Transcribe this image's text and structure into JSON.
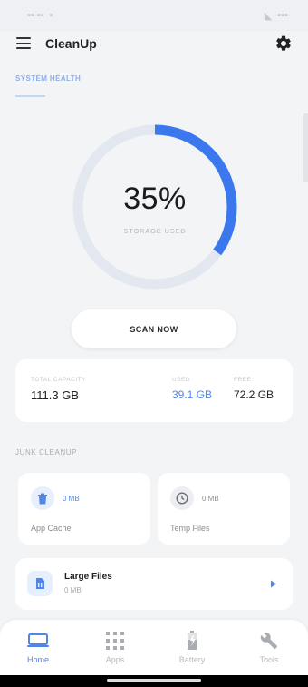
{
  "app": {
    "title": "CleanUp"
  },
  "tabs": [
    {
      "label": "SYSTEM HEALTH",
      "active": true
    }
  ],
  "gauge": {
    "percent_text": "35%",
    "caption": "STORAGE USED",
    "used_fraction": 0.35,
    "track_color": "#e3e8f0",
    "fill_color": "#3b78ee"
  },
  "scan": {
    "label": "SCAN NOW"
  },
  "storage": {
    "total_label": "TOTAL CAPACITY",
    "total_value": "111.3 GB",
    "used_label": "USED",
    "used_value": "39.1 GB",
    "free_label": "FREE",
    "free_value": "72.2 GB"
  },
  "junk": {
    "section_title": "JUNK CLEANUP",
    "app_cache": {
      "size": "0 MB",
      "name": "App Cache",
      "icon": "trash-icon"
    },
    "temp_files": {
      "size": "0 MB",
      "name": "Temp Files",
      "icon": "clock-icon"
    },
    "large_files": {
      "name": "Large Files",
      "size": "0 MB",
      "icon": "file-icon"
    }
  },
  "nav": [
    {
      "label": "Home",
      "icon": "monitor-icon",
      "active": true
    },
    {
      "label": "Apps",
      "icon": "grid-icon",
      "active": false
    },
    {
      "label": "Battery",
      "icon": "battery-icon",
      "active": false
    },
    {
      "label": "Tools",
      "icon": "wrench-icon",
      "active": false
    }
  ],
  "colors": {
    "accent": "#4f86e8",
    "background": "#f3f4f6"
  }
}
